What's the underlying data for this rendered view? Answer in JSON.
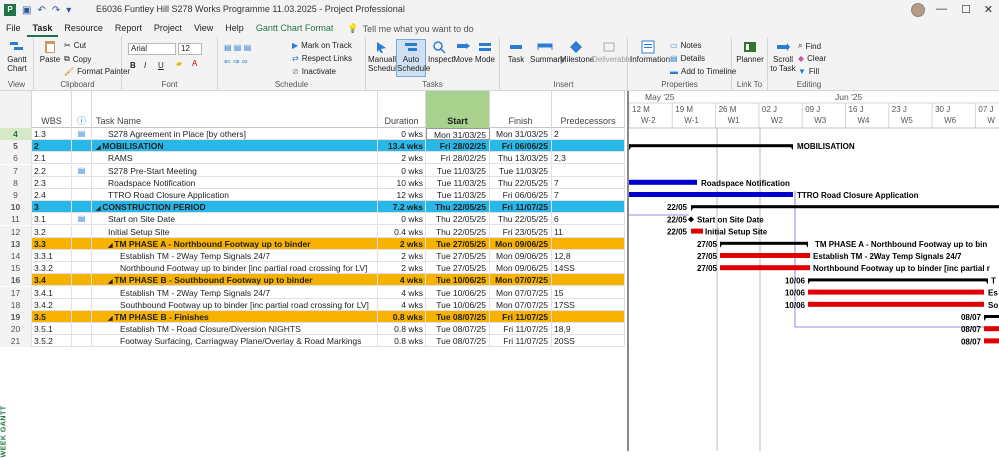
{
  "titlebar": {
    "title": "E6036 Funtley Hill S278 Works Programme 11.03.2025  -  Project Professional",
    "minimize": "—",
    "maximize": "☐",
    "close": "✕"
  },
  "menu": {
    "tabs": [
      "File",
      "Task",
      "Resource",
      "Report",
      "Project",
      "View",
      "Help",
      "Gantt Chart Format"
    ],
    "tell": "Tell me what you want to do"
  },
  "ribbon": {
    "view": {
      "gantt": "Gantt Chart",
      "label": "View"
    },
    "clipboard": {
      "paste": "Paste",
      "cut": "Cut",
      "copy": "Copy",
      "format_painter": "Format Painter",
      "label": "Clipboard"
    },
    "font": {
      "family": "Arial",
      "size": "12",
      "bold": "B",
      "italic": "I",
      "underline": "U",
      "label": "Font"
    },
    "schedule": {
      "mark_on_track": "Mark on Track",
      "respect_links": "Respect Links",
      "inactivate": "Inactivate",
      "label": "Schedule"
    },
    "tasks": {
      "manually": "Manually Schedule",
      "auto": "Auto Schedule",
      "inspect": "Inspect",
      "move": "Move",
      "mode": "Mode",
      "label": "Tasks"
    },
    "insert": {
      "task": "Task",
      "summary": "Summary",
      "milestone": "Milestone",
      "deliverable": "Deliverable",
      "label": "Insert"
    },
    "properties": {
      "information": "Information",
      "notes": "Notes",
      "details": "Details",
      "add_to_timeline": "Add to Timeline",
      "label": "Properties"
    },
    "link": {
      "planner": "Planner",
      "label": "Link To"
    },
    "editing": {
      "scroll": "Scroll to Task",
      "find": "Find",
      "clear": "Clear",
      "fill": "Fill",
      "label": "Editing"
    }
  },
  "columns": {
    "wbs": "WBS",
    "name": "Task Name",
    "duration": "Duration",
    "start": "Start",
    "finish": "Finish",
    "pred": "Predecessors"
  },
  "rows": [
    {
      "id": "4",
      "wbs": "1.3",
      "ind": "note",
      "name": "S278 Agreement in Place [by others]",
      "dur": "0 wks",
      "start": "Mon 31/03/25",
      "finish": "Mon 31/03/25",
      "pred": "2",
      "style": "",
      "indent": 1
    },
    {
      "id": "5",
      "wbs": "2",
      "ind": "",
      "name": "MOBILISATION",
      "dur": "13.4 wks",
      "start": "Fri 28/02/25",
      "finish": "Fri 06/06/25",
      "pred": "",
      "style": "blue",
      "indent": 0
    },
    {
      "id": "6",
      "wbs": "2.1",
      "ind": "",
      "name": "RAMS",
      "dur": "2 wks",
      "start": "Fri 28/02/25",
      "finish": "Thu 13/03/25",
      "pred": "2,3",
      "style": "",
      "indent": 1
    },
    {
      "id": "7",
      "wbs": "2.2",
      "ind": "note",
      "name": "S278 Pre-Start Meeting",
      "dur": "0 wks",
      "start": "Tue 11/03/25",
      "finish": "Tue 11/03/25",
      "pred": "",
      "style": "",
      "indent": 1
    },
    {
      "id": "8",
      "wbs": "2.3",
      "ind": "",
      "name": "Roadspace Notification",
      "dur": "10 wks",
      "start": "Tue 11/03/25",
      "finish": "Thu 22/05/25",
      "pred": "7",
      "style": "",
      "indent": 1
    },
    {
      "id": "9",
      "wbs": "2.4",
      "ind": "",
      "name": "TTRO Road Closure Application",
      "dur": "12 wks",
      "start": "Tue 11/03/25",
      "finish": "Fri 06/06/25",
      "pred": "7",
      "style": "",
      "indent": 1
    },
    {
      "id": "10",
      "wbs": "3",
      "ind": "",
      "name": "CONSTRUCTION PERIOD",
      "dur": "7.2 wks",
      "start": "Thu 22/05/25",
      "finish": "Fri 11/07/25",
      "pred": "",
      "style": "blue",
      "indent": 0
    },
    {
      "id": "11",
      "wbs": "3.1",
      "ind": "note",
      "name": "Start on Site Date",
      "dur": "0 wks",
      "start": "Thu 22/05/25",
      "finish": "Thu 22/05/25",
      "pred": "6",
      "style": "",
      "indent": 1
    },
    {
      "id": "12",
      "wbs": "3.2",
      "ind": "",
      "name": "Initial Setup Site",
      "dur": "0.4 wks",
      "start": "Thu 22/05/25",
      "finish": "Fri 23/05/25",
      "pred": "11",
      "style": "",
      "indent": 1
    },
    {
      "id": "13",
      "wbs": "3.3",
      "ind": "",
      "name": "TM PHASE A - Northbound Footway up to binder",
      "dur": "2 wks",
      "start": "Tue 27/05/25",
      "finish": "Mon 09/06/25",
      "pred": "",
      "style": "amber",
      "indent": 1
    },
    {
      "id": "14",
      "wbs": "3.3.1",
      "ind": "",
      "name": "Establish TM - 2Way Temp Signals 24/7",
      "dur": "2 wks",
      "start": "Tue 27/05/25",
      "finish": "Mon 09/06/25",
      "pred": "12,8",
      "style": "",
      "indent": 2
    },
    {
      "id": "15",
      "wbs": "3.3.2",
      "ind": "",
      "name": "Northbound Footway up to binder [inc partial road crossing for LV]",
      "dur": "2 wks",
      "start": "Tue 27/05/25",
      "finish": "Mon 09/06/25",
      "pred": "14SS",
      "style": "",
      "indent": 2
    },
    {
      "id": "16",
      "wbs": "3.4",
      "ind": "",
      "name": "TM PHASE B - Southbound Footway up to binder",
      "dur": "4 wks",
      "start": "Tue 10/06/25",
      "finish": "Mon 07/07/25",
      "pred": "",
      "style": "amber",
      "indent": 1
    },
    {
      "id": "17",
      "wbs": "3.4.1",
      "ind": "",
      "name": "Establish TM - 2Way Temp Signals 24/7",
      "dur": "4 wks",
      "start": "Tue 10/06/25",
      "finish": "Mon 07/07/25",
      "pred": "15",
      "style": "",
      "indent": 2
    },
    {
      "id": "18",
      "wbs": "3.4.2",
      "ind": "",
      "name": "Southbound Footway up to binder [inc partial road crossing for LV]",
      "dur": "4 wks",
      "start": "Tue 10/06/25",
      "finish": "Mon 07/07/25",
      "pred": "17SS",
      "style": "",
      "indent": 2
    },
    {
      "id": "19",
      "wbs": "3.5",
      "ind": "",
      "name": "TM PHASE B - Finishes",
      "dur": "0.8 wks",
      "start": "Tue 08/07/25",
      "finish": "Fri 11/07/25",
      "pred": "",
      "style": "amber",
      "indent": 1
    },
    {
      "id": "20",
      "wbs": "3.5.1",
      "ind": "",
      "name": "Establish TM - Road Closure/Diversion NIGHTS",
      "dur": "0.8 wks",
      "start": "Tue 08/07/25",
      "finish": "Fri 11/07/25",
      "pred": "18,9",
      "style": "",
      "indent": 2
    },
    {
      "id": "21",
      "wbs": "3.5.2",
      "ind": "",
      "name": "Footway Surfacing, Carriagway Plane/Overlay & Road Markings",
      "dur": "0.8 wks",
      "start": "Tue 08/07/25",
      "finish": "Fri 11/07/25",
      "pred": "20SS",
      "style": "",
      "indent": 2
    }
  ],
  "gantt": {
    "months": [
      "May '25",
      "Jun '25"
    ],
    "dates": [
      "12 M",
      "19 M",
      "26 M",
      "02 J",
      "09 J",
      "16 J",
      "23 J",
      "30 J",
      "07 J"
    ],
    "weeks": [
      "W-2",
      "W-1",
      "W1",
      "W2",
      "W3",
      "W4",
      "W5",
      "W6",
      "W"
    ],
    "labels": [
      "MOBILISATION",
      "Roadspace Notification",
      "TTRO Road Closure Application",
      "22/05",
      "22/05",
      "Start on Site Date",
      "22/05",
      "Initial Setup Site",
      "27/05",
      "TM PHASE A - Northbound Footway up to bin",
      "27/05",
      "Establish TM - 2Way Temp Signals 24/7",
      "27/05",
      "Northbound Footway up to binder [inc partial r",
      "10/06",
      "T",
      "10/06",
      "Es",
      "10/06",
      "So",
      "08/07",
      "08/07",
      "08/07"
    ],
    "side_label": "WEEK GANTT"
  }
}
